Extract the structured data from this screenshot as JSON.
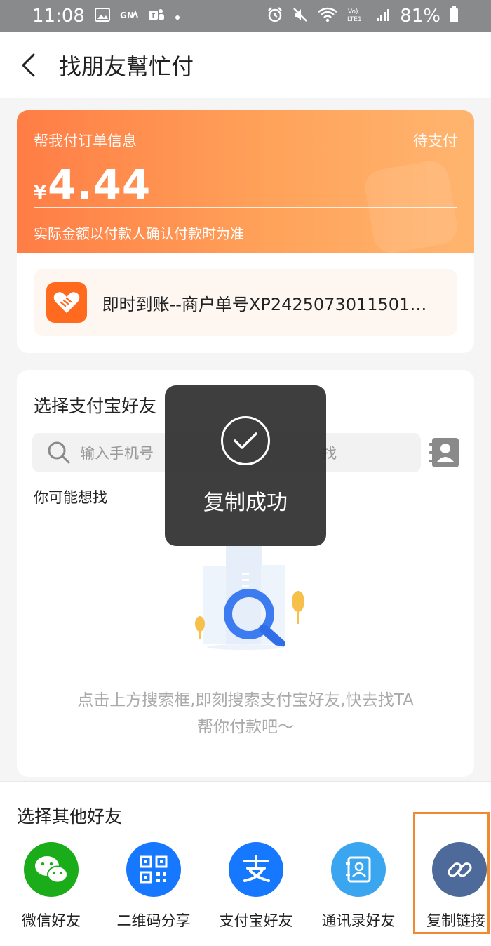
{
  "status_bar": {
    "time": "11:08",
    "battery": "81%"
  },
  "nav": {
    "title": "找朋友幫忙付"
  },
  "order": {
    "label": "帮我付订单信息",
    "status": "待支付",
    "currency": "¥",
    "amount": "4.44",
    "note": "实际金额以付款人确认付款时为准",
    "merchant_text": "即时到账--商户单号XP2425073011501…"
  },
  "friends": {
    "title": "选择支付宝好友",
    "search_placeholder": "输入手机号",
    "search_tail": "找",
    "maybe_label": "你可能想找",
    "empty_text_1": "点击上方搜索框,即刻搜索支付宝好友,快去找TA",
    "empty_text_2": "帮你付款吧～"
  },
  "toast": {
    "text": "复制成功"
  },
  "other": {
    "title": "选择其他好友",
    "items": [
      {
        "label": "微信好友",
        "icon": "wechat-icon",
        "color": "#1aad19"
      },
      {
        "label": "二维码分享",
        "icon": "qrcode-icon",
        "color": "#1677ff"
      },
      {
        "label": "支付宝好友",
        "icon": "alipay-icon",
        "color": "#1677ff"
      },
      {
        "label": "通讯录好友",
        "icon": "contacts-icon",
        "color": "#3aa6f0"
      },
      {
        "label": "复制链接",
        "icon": "link-icon",
        "color": "#4d6a9a"
      }
    ]
  },
  "colors": {
    "accent": "#ff8a4c",
    "highlight": "#f08a30"
  }
}
